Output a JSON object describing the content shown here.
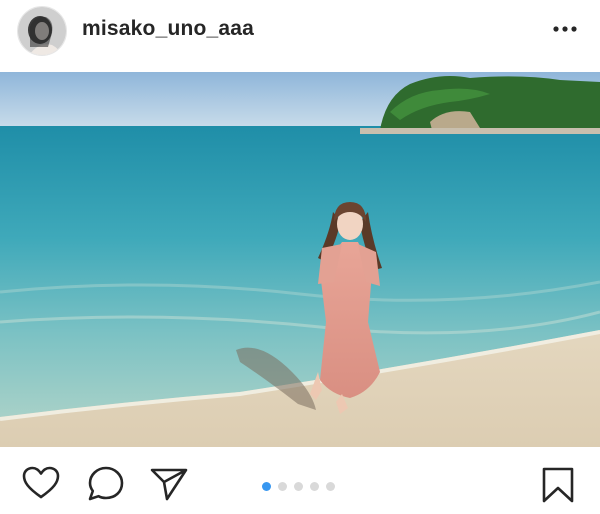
{
  "post": {
    "username": "misako_uno_aaa",
    "carousel": {
      "count": 5,
      "active_index": 0
    }
  },
  "icons": {
    "avatar": "profile-photo",
    "more": "ellipsis-icon",
    "like": "heart-icon",
    "comment": "speech-bubble-icon",
    "share": "paper-plane-icon",
    "save": "bookmark-icon"
  },
  "colors": {
    "text": "#262626",
    "carousel_active": "#3897f0",
    "carousel_inactive": "#d9d9d9"
  }
}
